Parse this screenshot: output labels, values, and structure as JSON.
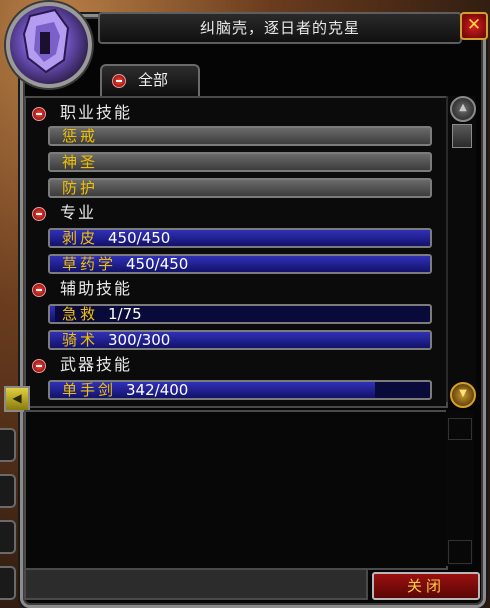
{
  "window": {
    "title": "纠脑壳，逐日者的克星",
    "close_label": "关闭",
    "close_x": "✕"
  },
  "tab": {
    "label": "全部"
  },
  "groups": [
    {
      "header": "职业技能",
      "skills": [
        {
          "name": "惩戒",
          "rank": "",
          "fraction": 0
        },
        {
          "name": "神圣",
          "rank": "",
          "fraction": 0
        },
        {
          "name": "防护",
          "rank": "",
          "fraction": 0
        }
      ]
    },
    {
      "header": "专业",
      "skills": [
        {
          "name": "剥皮",
          "rank": "450/450",
          "fraction": 1.0
        },
        {
          "name": "草药学",
          "rank": "450/450",
          "fraction": 1.0
        }
      ]
    },
    {
      "header": "辅助技能",
      "skills": [
        {
          "name": "急救",
          "rank": "1/75",
          "fraction": 0.013
        },
        {
          "name": "骑术",
          "rank": "300/300",
          "fraction": 1.0
        }
      ]
    },
    {
      "header": "武器技能",
      "skills": [
        {
          "name": "单手剑",
          "rank": "342/400",
          "fraction": 0.855
        }
      ]
    }
  ],
  "icons": {
    "portrait": "purple-helmet-portrait-icon",
    "scroll_up": "scroll-up-arrow-icon",
    "scroll_down": "scroll-down-arrow-icon",
    "speaker": "speaker-icon",
    "collapse": "minus-icon"
  },
  "colors": {
    "skill_name": "#f0c000",
    "bar_fill": "#3030b8",
    "close_text": "#ffcf3a"
  }
}
